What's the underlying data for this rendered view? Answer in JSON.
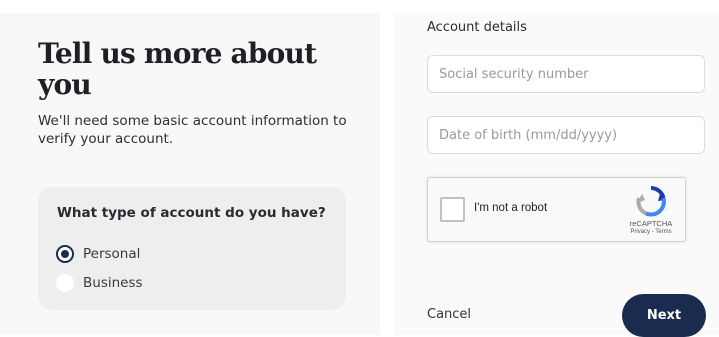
{
  "left_panel": {
    "title": "Tell us more about you",
    "subtitle": "We'll need some basic account information to verify your account.",
    "account_type": {
      "question": "What type of account do you have?",
      "options": [
        {
          "label": "Personal",
          "selected": true
        },
        {
          "label": "Business",
          "selected": false
        }
      ]
    }
  },
  "right_panel": {
    "section_title": "Account details",
    "ssn_field": {
      "placeholder": "Social security number",
      "value": ""
    },
    "dob_field": {
      "placeholder": "Date of birth (mm/dd/yyyy)",
      "value": ""
    },
    "recaptcha": {
      "label": "I'm not a robot",
      "brand": "reCAPTCHA",
      "links": "Privacy - Terms",
      "checked": false
    },
    "cancel_label": "Cancel",
    "next_label": "Next"
  },
  "colors": {
    "accent": "#1b2b4f",
    "card_bg": "#eeeeee",
    "panel_bg": "#f8f8f8"
  },
  "icons": [
    "radio-checked-icon",
    "radio-unchecked-icon",
    "checkbox-icon",
    "recaptcha-logo-icon"
  ]
}
